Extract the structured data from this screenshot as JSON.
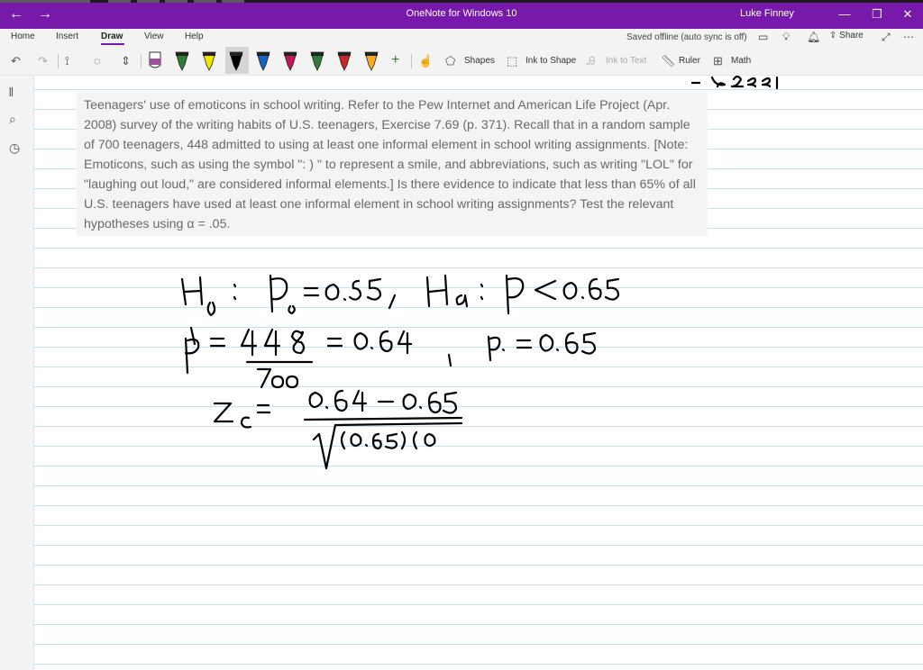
{
  "titlebar": {
    "app_title": "OneNote for Windows 10",
    "user_name": "Luke Finney",
    "back_icon": "back-arrow-icon",
    "forward_icon": "forward-arrow-icon",
    "minimize_icon": "minimize-icon",
    "restore_icon": "restore-icon",
    "close_icon": "close-icon",
    "accent_color": "#7719aa"
  },
  "menu": {
    "items": [
      {
        "label": "Home"
      },
      {
        "label": "Insert"
      },
      {
        "label": "Draw"
      },
      {
        "label": "View"
      },
      {
        "label": "Help"
      }
    ],
    "active": "Draw",
    "sync_status": "Saved offline (auto sync is off)",
    "share_label": "Share"
  },
  "toolbar": {
    "shapes_label": "Shapes",
    "ink_to_shape_label": "Ink to Shape",
    "ink_to_text_label": "Ink to Text",
    "ruler_label": "Ruler",
    "math_label": "Math",
    "pens": [
      {
        "color": "#a0509c"
      },
      {
        "color": "#2e7d32"
      },
      {
        "color": "#f2e600"
      },
      {
        "color": "#000000"
      },
      {
        "color": "#1565c0"
      },
      {
        "color": "#c2185b"
      },
      {
        "color": "#2e7d32"
      },
      {
        "color": "#c62828"
      },
      {
        "color": "#f9a825"
      }
    ]
  },
  "problem": {
    "text": "Teenagers' use of emoticons in school writing. Refer to the Pew Internet and American Life Project (Apr. 2008) survey of the writing habits of U.S. teenagers, Exercise 7.69 (p. 371). Recall that in a random sample of 700 teenagers, 448 admitted to using at least one informal element in school writing assignments. [Note: Emoticons, such as using the symbol \": ) \" to represent a smile, and abbreviations, such as writing \"LOL\" for \"laughing out loud,\" are considered informal elements.] Is there evidence to indicate that less than 65% of all U.S. teenagers have used at least one informal element in school writing assignments? Test the relevant hypotheses using α = .05."
  }
}
